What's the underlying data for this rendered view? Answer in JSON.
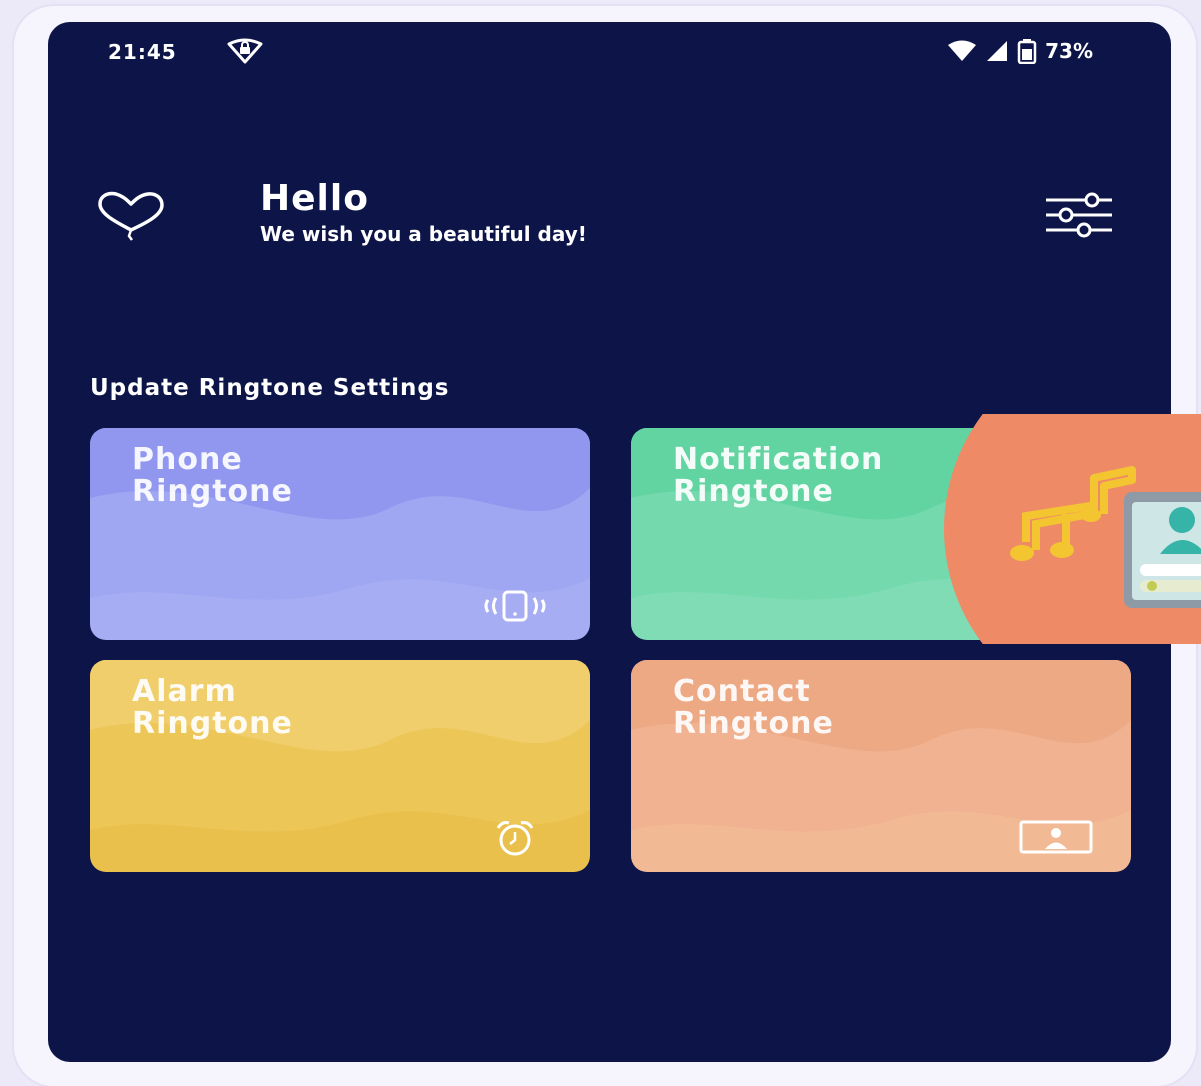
{
  "status_bar": {
    "time": "21:45",
    "battery": "73%",
    "icons": [
      "vpn-icon",
      "wifi-icon",
      "signal-icon",
      "battery-icon"
    ]
  },
  "header": {
    "title": "Hello",
    "subtitle": "We wish you a beautiful day!",
    "icons": [
      "heart-balloon-icon",
      "filter-settings-icon"
    ]
  },
  "section": {
    "title": "Update Ringtone Settings"
  },
  "cards": [
    {
      "line1": "Phone",
      "line2": "Ringtone",
      "icon": "phone-vibrate-icon",
      "color": "#a7adf2"
    },
    {
      "line1": "Notification",
      "line2": "Ringtone",
      "icon": "notification-icon",
      "color": "#7fdcb5"
    },
    {
      "line1": "Alarm",
      "line2": "Ringtone",
      "icon": "alarm-clock-icon",
      "color": "#e9c04c"
    },
    {
      "line1": "Contact",
      "line2": "Ringtone",
      "icon": "contact-card-icon",
      "color": "#f2b995"
    }
  ],
  "colors": {
    "background": "#0d1548",
    "phone_card": "#a7adf2",
    "notification_card": "#7fdcb5",
    "alarm_card": "#e9c04c",
    "contact_card": "#f2b995",
    "logo_circle": "#ef8a67"
  }
}
